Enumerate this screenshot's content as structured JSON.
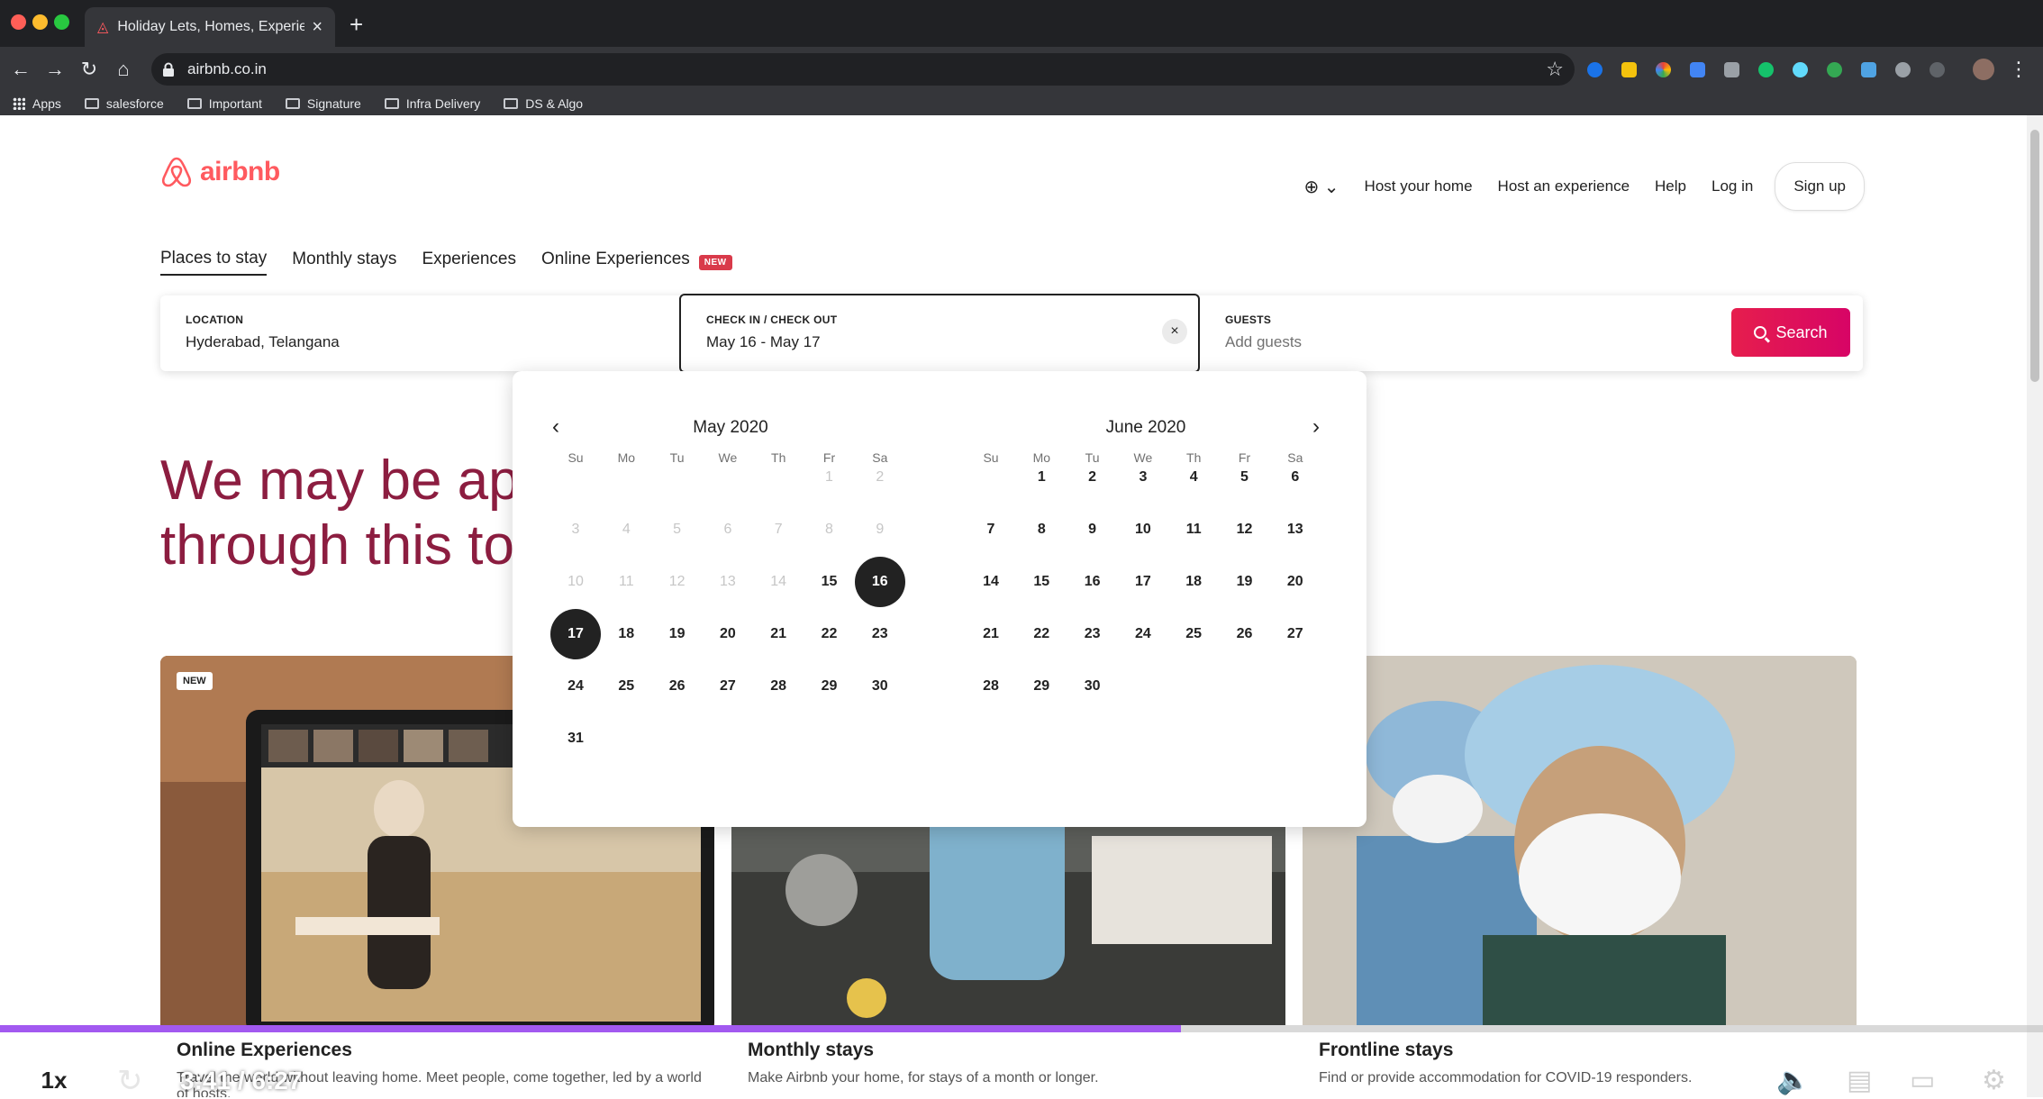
{
  "browser": {
    "tab_title": "Holiday Lets, Homes, Experiences",
    "url": "airbnb.co.in",
    "bookmarks": [
      "Apps",
      "salesforce",
      "Important",
      "Signature",
      "Infra Delivery",
      "DS & Algo"
    ]
  },
  "header": {
    "logo_text": "airbnb",
    "nav": [
      "Host your home",
      "Host an experience",
      "Help",
      "Log in"
    ],
    "signup": "Sign up"
  },
  "tabs": [
    "Places to stay",
    "Monthly stays",
    "Experiences",
    "Online Experiences"
  ],
  "tabs_badge": "NEW",
  "search": {
    "location_label": "LOCATION",
    "location_value": "Hyderabad, Telangana",
    "dates_label": "CHECK IN / CHECK OUT",
    "dates_value": "May 16 - May 17",
    "clear_icon": "×",
    "guests_label": "GUESTS",
    "guests_placeholder": "Add guests",
    "button": "Search"
  },
  "hero": {
    "line1": "We may be apa",
    "line2": "through this tog"
  },
  "calendar": {
    "weekdays": [
      "Su",
      "Mo",
      "Tu",
      "We",
      "Th",
      "Fr",
      "Sa"
    ],
    "months": [
      {
        "title": "May 2020",
        "first_weekday": 5,
        "days": 31,
        "past_until": 14
      },
      {
        "title": "June 2020",
        "first_weekday": 1,
        "days": 30,
        "past_until": 0
      }
    ],
    "selected": [
      "May 16",
      "May 17"
    ]
  },
  "cards": [
    {
      "title": "Online Experiences",
      "subtitle": "Travel the world without leaving home. Meet people, come together, led by a world of hosts.",
      "badge": "NEW"
    },
    {
      "title": "Monthly stays",
      "subtitle": "Make Airbnb your home, for stays of a month or longer.",
      "badge": ""
    },
    {
      "title": "Frontline stays",
      "subtitle": "Find or provide accommodation for COVID-19 responders.",
      "badge": ""
    }
  ],
  "player": {
    "speed": "1x",
    "time": "3:41 / 6:27",
    "progress": 0.578
  },
  "colors": {
    "brand": "#ff5a5f",
    "search_button": "#e61e4d",
    "hero_text": "#8c1d40",
    "progress": "#a259f0"
  }
}
